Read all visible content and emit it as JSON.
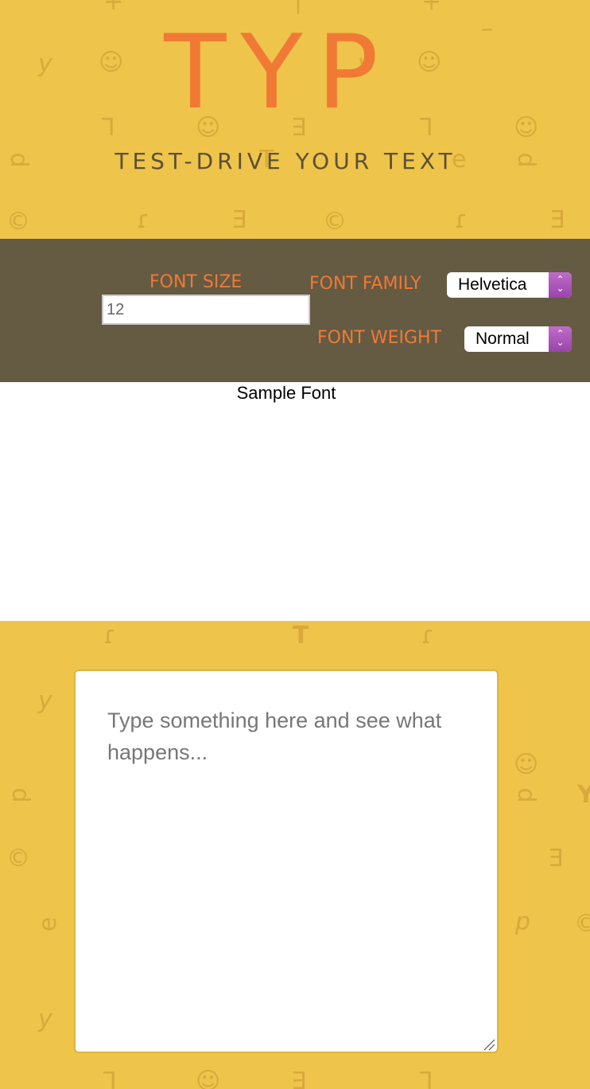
{
  "header": {
    "logo": "TYP",
    "tagline": "TEST-DRIVE YOUR TEXT"
  },
  "controls": {
    "font_size_label": "FONT SIZE",
    "font_size_value": "12",
    "font_family_label": "FONT FAMILY",
    "font_family_selected": "Helvetica",
    "font_weight_label": "FONT WEIGHT",
    "font_weight_selected": "Normal"
  },
  "sample": {
    "text": "Sample Font"
  },
  "editor": {
    "placeholder": "Type something here and see what happens..."
  },
  "colors": {
    "yellow_bg": "#eec44b",
    "dark_band": "#655a42",
    "accent_orange": "#f07a35",
    "select_arrow_purple": "#aa55bb"
  }
}
